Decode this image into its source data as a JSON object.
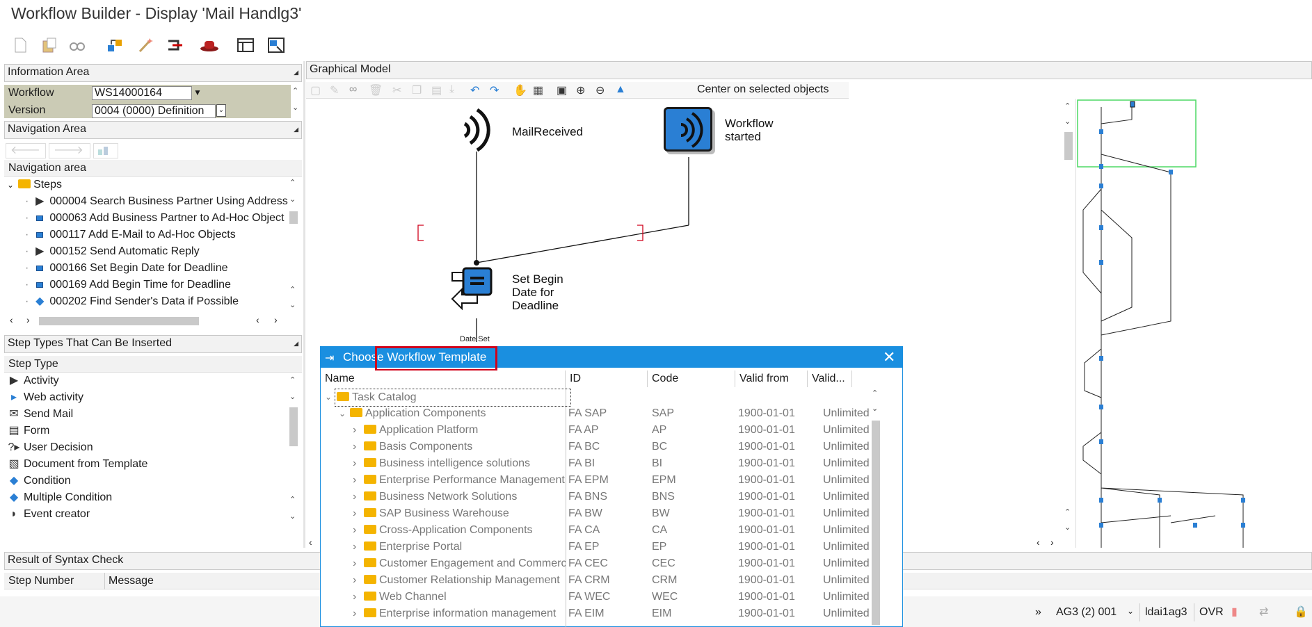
{
  "window": {
    "title": "Workflow Builder - Display 'Mail Handlg3'"
  },
  "toolbar": {
    "icons": [
      "new-icon",
      "paste-icon",
      "glasses-icon",
      "move-icon",
      "wand-icon",
      "execute-icon",
      "hat-icon",
      "layout-icon",
      "window-icon"
    ]
  },
  "info_area": {
    "title": "Information Area",
    "workflow_label": "Workflow",
    "workflow_value": "WS14000164",
    "version_label": "Version",
    "version_value": "0004 (0000) Definition"
  },
  "nav_area": {
    "title": "Navigation Area",
    "header": "Navigation area",
    "root": "Steps",
    "items": [
      {
        "id": "000004",
        "label": "000004 Search Business Partner Using Address",
        "icon": "activity-icon"
      },
      {
        "id": "000063",
        "label": "000063 Add Business Partner to Ad-Hoc Object",
        "icon": "container-op-icon"
      },
      {
        "id": "000117",
        "label": "000117 Add E-Mail to Ad-Hoc Objects",
        "icon": "container-op-icon"
      },
      {
        "id": "000152",
        "label": "000152 Send Automatic Reply",
        "icon": "activity-icon"
      },
      {
        "id": "000166",
        "label": "000166 Set Begin Date for Deadline",
        "icon": "container-op-icon"
      },
      {
        "id": "000169",
        "label": "000169 Add Begin Time for Deadline",
        "icon": "container-op-icon"
      },
      {
        "id": "000202",
        "label": "000202 Find Sender's Data if Possible",
        "icon": "condition-icon"
      }
    ]
  },
  "step_types": {
    "title": "Step Types That Can Be Inserted",
    "header": "Step Type",
    "items": [
      {
        "label": "Activity",
        "icon": "activity-icon"
      },
      {
        "label": "Web activity",
        "icon": "web-activity-icon"
      },
      {
        "label": "Send Mail",
        "icon": "send-mail-icon"
      },
      {
        "label": "Form",
        "icon": "form-icon"
      },
      {
        "label": "User Decision",
        "icon": "user-decision-icon"
      },
      {
        "label": "Document from Template",
        "icon": "document-icon"
      },
      {
        "label": "Condition",
        "icon": "condition-icon"
      },
      {
        "label": "Multiple Condition",
        "icon": "multiple-condition-icon"
      },
      {
        "label": "Event creator",
        "icon": "event-creator-icon"
      }
    ]
  },
  "syntax": {
    "title": "Result of Syntax Check",
    "col_step": "Step Number",
    "col_message": "Message"
  },
  "graphical_model": {
    "title": "Graphical Model",
    "center_button": "Center on selected objects",
    "nodes": {
      "mail_received": "MailReceived",
      "workflow_started_1": "Workflow",
      "workflow_started_2": "started",
      "set_begin_1": "Set Begin",
      "set_begin_2": "Date for",
      "set_begin_3": "Deadline",
      "date_set": "Date Set"
    }
  },
  "dialog": {
    "title": "Choose Workflow Template",
    "columns": {
      "name": "Name",
      "id": "ID",
      "code": "Code",
      "valid_from": "Valid from",
      "valid_to": "Valid..."
    },
    "root": "Task Catalog",
    "group": {
      "name": "Application Components",
      "id": "FA SAP",
      "code": "SAP",
      "from": "1900-01-01",
      "to": "Unlimited"
    },
    "rows": [
      {
        "name": "Application Platform",
        "id": "FA AP",
        "code": "AP",
        "from": "1900-01-01",
        "to": "Unlimited"
      },
      {
        "name": "Basis Components",
        "id": "FA BC",
        "code": "BC",
        "from": "1900-01-01",
        "to": "Unlimited"
      },
      {
        "name": "Business intelligence solutions",
        "id": "FA BI",
        "code": "BI",
        "from": "1900-01-01",
        "to": "Unlimited"
      },
      {
        "name": "Enterprise Performance Management",
        "id": "FA EPM",
        "code": "EPM",
        "from": "1900-01-01",
        "to": "Unlimited"
      },
      {
        "name": "Business Network Solutions",
        "id": "FA BNS",
        "code": "BNS",
        "from": "1900-01-01",
        "to": "Unlimited"
      },
      {
        "name": "SAP Business Warehouse",
        "id": "FA BW",
        "code": "BW",
        "from": "1900-01-01",
        "to": "Unlimited"
      },
      {
        "name": "Cross-Application Components",
        "id": "FA CA",
        "code": "CA",
        "from": "1900-01-01",
        "to": "Unlimited"
      },
      {
        "name": "Enterprise Portal",
        "id": "FA EP",
        "code": "EP",
        "from": "1900-01-01",
        "to": "Unlimited"
      },
      {
        "name": "Customer Engagement and Commerce",
        "id": "FA CEC",
        "code": "CEC",
        "from": "1900-01-01",
        "to": "Unlimited"
      },
      {
        "name": "Customer Relationship Management",
        "id": "FA CRM",
        "code": "CRM",
        "from": "1900-01-01",
        "to": "Unlimited"
      },
      {
        "name": "Web Channel",
        "id": "FA WEC",
        "code": "WEC",
        "from": "1900-01-01",
        "to": "Unlimited"
      },
      {
        "name": "Enterprise information management",
        "id": "FA EIM",
        "code": "EIM",
        "from": "1900-01-01",
        "to": "Unlimited"
      }
    ]
  },
  "status_bar": {
    "system": "AG3 (2) 001",
    "server": "ldai1ag3",
    "mode": "OVR"
  },
  "colors": {
    "accent": "#1a8fe0",
    "highlight_box": "#d0021b",
    "folder": "#f4b400",
    "node_blue": "#2a7fd4"
  }
}
